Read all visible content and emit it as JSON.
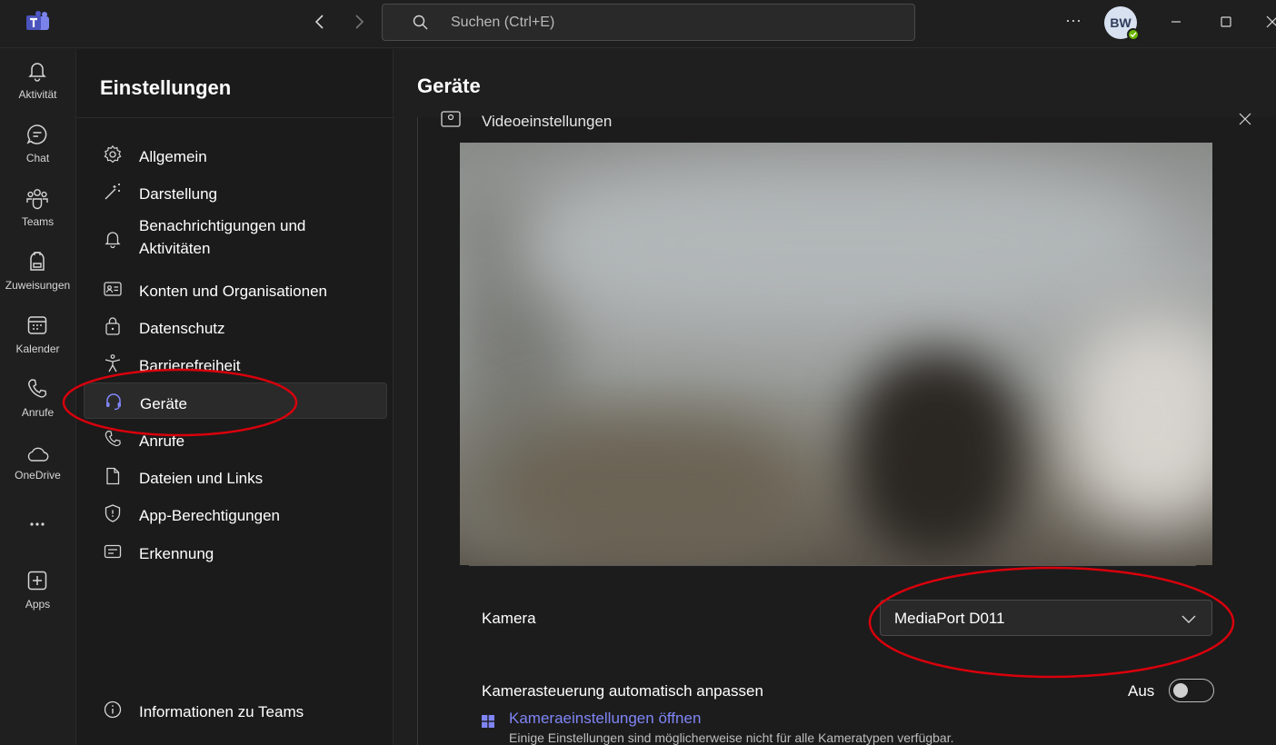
{
  "search": {
    "placeholder": "Suchen (Ctrl+E)"
  },
  "user": {
    "initials": "BW"
  },
  "rail": {
    "items": [
      {
        "label": "Aktivität"
      },
      {
        "label": "Chat"
      },
      {
        "label": "Teams"
      },
      {
        "label": "Zuweisungen"
      },
      {
        "label": "Kalender"
      },
      {
        "label": "Anrufe"
      },
      {
        "label": "OneDrive"
      },
      {
        "label": "Apps"
      }
    ]
  },
  "settings": {
    "title": "Einstellungen",
    "menu": [
      {
        "label": "Allgemein"
      },
      {
        "label": "Darstellung"
      },
      {
        "label": "Benachrichtigungen und Aktivitäten"
      },
      {
        "label": "Konten und Organisationen"
      },
      {
        "label": "Datenschutz"
      },
      {
        "label": "Barrierefreiheit"
      },
      {
        "label": "Geräte"
      },
      {
        "label": "Anrufe"
      },
      {
        "label": "Dateien und Links"
      },
      {
        "label": "App-Berechtigungen"
      },
      {
        "label": "Erkennung"
      }
    ],
    "active_item": "Geräte",
    "about": "Informationen zu Teams"
  },
  "content": {
    "title": "Geräte",
    "section_label": "Videoeinstellungen",
    "camera_label": "Kamera",
    "camera_value": "MediaPort D011",
    "auto_adjust_label": "Kamerasteuerung automatisch anpassen",
    "auto_adjust_state": "Aus",
    "camera_settings_link": "Kameraeinstellungen öffnen",
    "hint": "Einige Einstellungen sind möglicherweise nicht für alle Kameratypen verfügbar."
  },
  "colors": {
    "accent": "#7f85f5",
    "annotation": "#d8000c",
    "background": "#1f1f1f"
  }
}
